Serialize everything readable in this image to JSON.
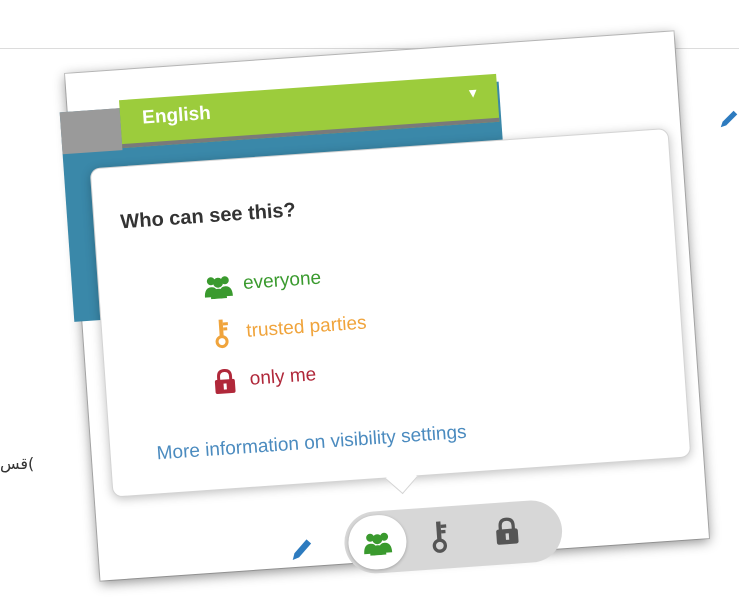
{
  "background": {
    "side_text": ")قس"
  },
  "language": {
    "selected": "English"
  },
  "visibility_popover": {
    "title": "Who can see this?",
    "options": [
      {
        "label": "everyone",
        "icon": "group-icon",
        "color": "#3a9a2e"
      },
      {
        "label": "trusted parties",
        "icon": "key-icon",
        "color": "#f0a43c"
      },
      {
        "label": "only me",
        "icon": "lock-icon",
        "color": "#b0283a"
      }
    ],
    "more_info_link": "More information on visibility settings"
  },
  "visibility_toggle": {
    "selected": "everyone",
    "options": [
      "everyone",
      "trusted parties",
      "only me"
    ]
  },
  "colors": {
    "accent_green": "#9ccc3c",
    "header_blue": "#3a88a9",
    "link_blue": "#4b8bbf",
    "edit_blue": "#2d7bbf"
  }
}
